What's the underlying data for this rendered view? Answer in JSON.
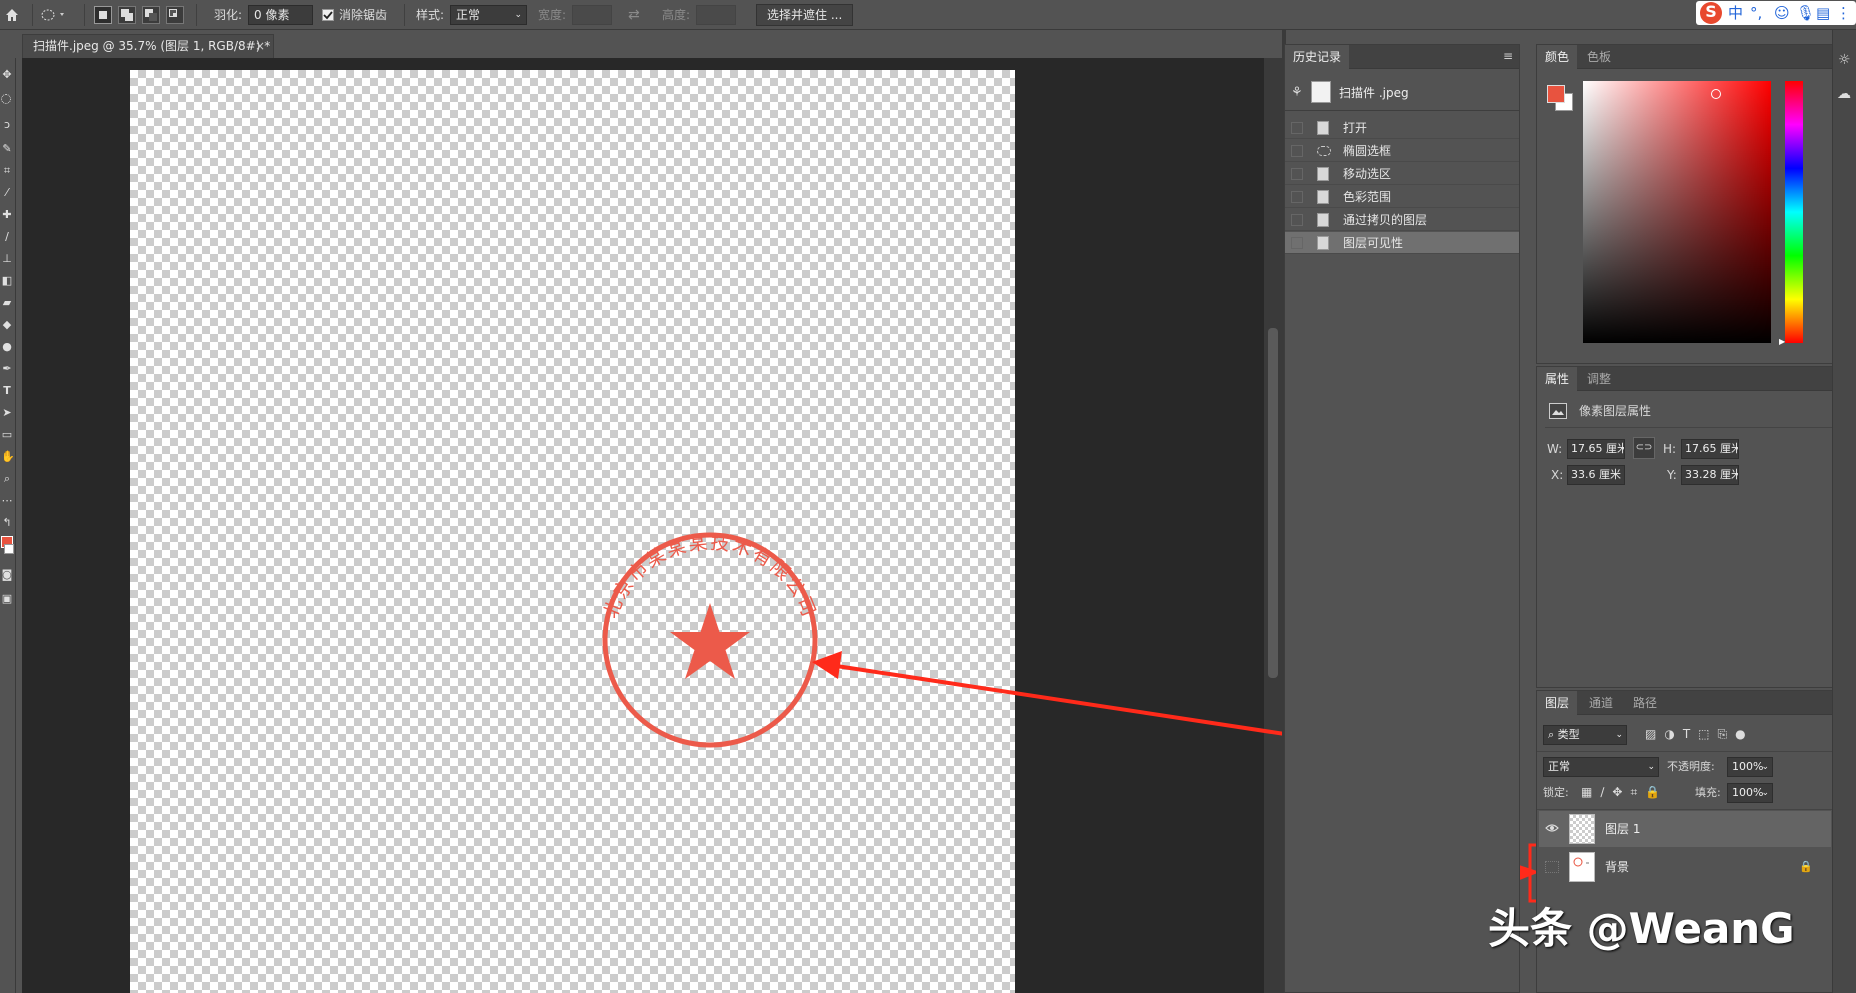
{
  "options_bar": {
    "feather_label": "羽化:",
    "feather_value": "0 像素",
    "antialias_label": "消除锯齿",
    "style_label": "样式:",
    "style_value": "正常",
    "width_label": "宽度:",
    "height_label": "高度:",
    "select_mask_button": "选择并遮住 ..."
  },
  "ime": {
    "chinese": "中",
    "punct": "°,"
  },
  "document": {
    "tab_title": "扫描件.jpeg @ 35.7% (图层 1, RGB/8#) *",
    "close": "×"
  },
  "stamp": {
    "arc_text": "北京市某某某技术有限公司"
  },
  "history": {
    "tab_label": "历史记录",
    "snapshot_label": "扫描件 .jpeg",
    "items": [
      {
        "label": "打开"
      },
      {
        "label": "椭圆选框"
      },
      {
        "label": "移动选区"
      },
      {
        "label": "色彩范围"
      },
      {
        "label": "通过拷贝的图层"
      },
      {
        "label": "图层可见性"
      }
    ]
  },
  "color": {
    "tab_color": "颜色",
    "tab_swatches": "色板",
    "foreground_color": "#e8533f",
    "hue_color": "#ff0000"
  },
  "properties": {
    "tab_properties": "属性",
    "tab_adjustments": "调整",
    "header": "像素图层属性",
    "w_label": "W:",
    "w_value": "17.65 厘米",
    "h_label": "H:",
    "h_value": "17.65 厘米",
    "x_label": "X:",
    "x_value": "33.6 厘米",
    "y_label": "Y:",
    "y_value": "33.28 厘米"
  },
  "layers": {
    "tab_layers": "图层",
    "tab_channels": "通道",
    "tab_paths": "路径",
    "filter_label": "类型",
    "blend_mode": "正常",
    "opacity_label": "不透明度:",
    "opacity_value": "100%",
    "lock_label": "锁定:",
    "fill_label": "填充:",
    "fill_value": "100%",
    "items": [
      {
        "name": "图层 1",
        "visible": true,
        "locked": false
      },
      {
        "name": "背景",
        "visible": false,
        "locked": true
      }
    ]
  },
  "annotations": {
    "highlight_color": "#ff2a1a"
  },
  "watermark": {
    "text": "头条 @WeanG"
  }
}
